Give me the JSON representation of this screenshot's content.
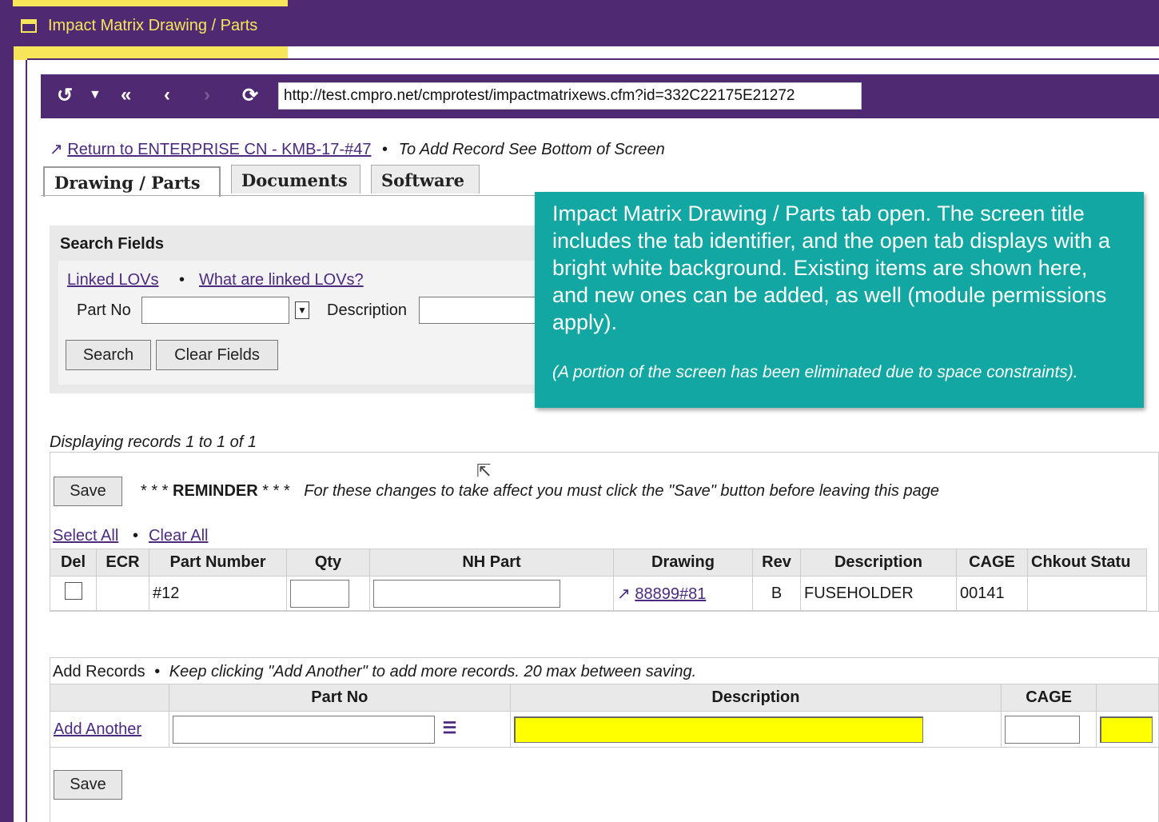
{
  "window": {
    "title": "Impact Matrix Drawing / Parts"
  },
  "toolbar": {
    "history_icon": "history-icon",
    "url": "http://test.cmpro.net/cmprotest/impactmatrixews.cfm?id=332C22175E21272"
  },
  "return_link": "Return to ENTERPRISE CN - KMB-17-#47",
  "separator": "•",
  "add_hint": "To Add Record See Bottom of Screen",
  "tabs": [
    "Drawing / Parts",
    "Documents",
    "Software"
  ],
  "search": {
    "title": "Search Fields",
    "linked_lovs": "Linked LOVs",
    "what_are": "What are linked LOVs?",
    "part_no_label": "Part No",
    "description_label": "Description",
    "search_button": "Search",
    "clear_button": "Clear Fields"
  },
  "callout": {
    "main": "Impact Matrix Drawing / Parts tab open.  The screen title includes the tab identifier, and the open tab displays with a bright white background. Existing items are shown here, and new ones can be added, as well (module permissions apply).",
    "note": "(A portion of the screen has been eliminated due to space constraints)."
  },
  "records": {
    "displaying": "Displaying records 1 to 1 of 1",
    "save": "Save",
    "reminder_stars": "* * *",
    "reminder_word": "REMINDER",
    "reminder_text": "For these changes to take affect you must click the \"Save\" button before leaving this page",
    "select_all": "Select All",
    "clear_all": "Clear All",
    "columns": [
      "Del",
      "ECR",
      "Part Number",
      "Qty",
      "NH Part",
      "Drawing",
      "Rev",
      "Description",
      "CAGE",
      "Chkout Statu"
    ],
    "row": {
      "part_number": "#12",
      "drawing": "88899#81",
      "rev": "B",
      "description": "FUSEHOLDER",
      "cage": "00141"
    }
  },
  "add": {
    "title": "Add Records",
    "hint": "Keep clicking \"Add Another\" to add more records. 20 max between saving.",
    "columns": [
      "Part No",
      "Description",
      "CAGE"
    ],
    "add_another": "Add Another",
    "save": "Save"
  },
  "colors": {
    "brand": "#4f2a72",
    "highlight": "#f7e65a",
    "callout": "#12a7a2",
    "required": "#ffff00"
  }
}
